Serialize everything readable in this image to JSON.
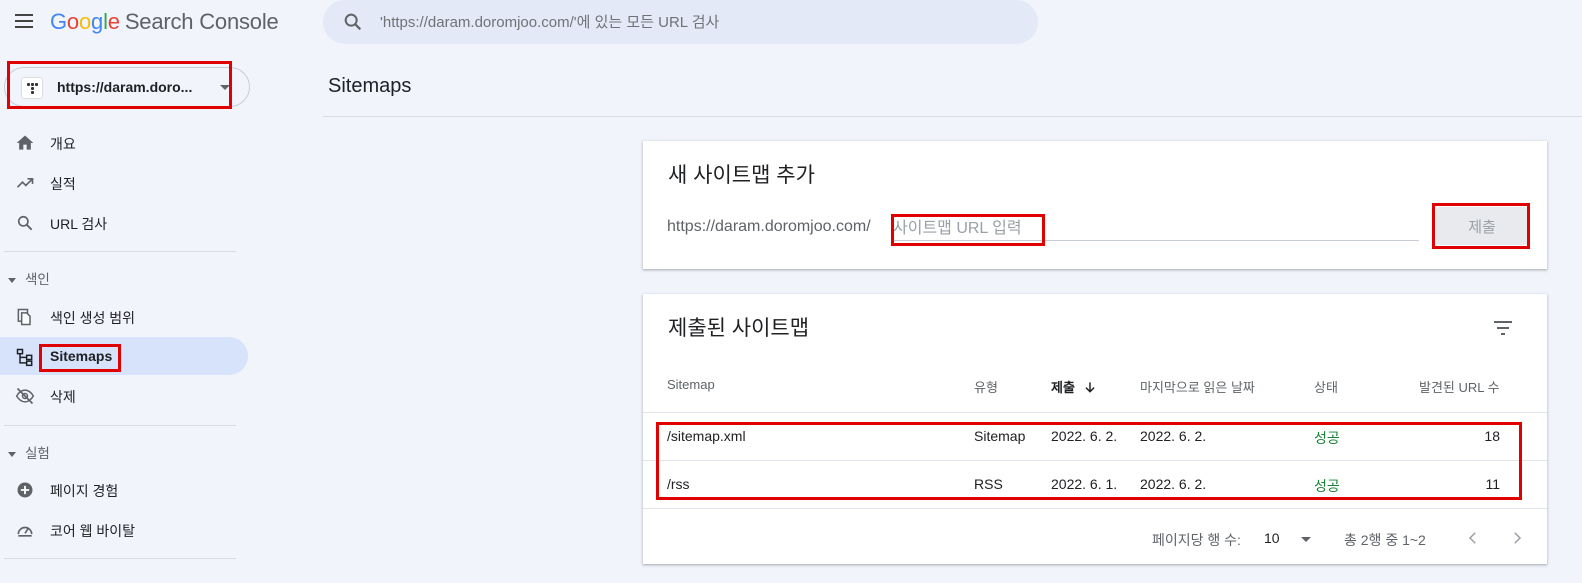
{
  "header": {
    "logo_letters": [
      "G",
      "o",
      "o",
      "g",
      "l",
      "e"
    ],
    "logo_product": "Search Console",
    "search_placeholder": "'https://daram.doromjoo.com/'에 있는 모든 URL 검사"
  },
  "property": {
    "url": "https://daram.doro..."
  },
  "sidebar": {
    "items": [
      {
        "label": "개요",
        "icon": "home-icon"
      },
      {
        "label": "실적",
        "icon": "trending-up-icon"
      },
      {
        "label": "URL 검사",
        "icon": "search-icon"
      }
    ],
    "section_index": "색인",
    "index_items": [
      {
        "label": "색인 생성 범위",
        "icon": "file-copy-icon"
      },
      {
        "label": "Sitemaps",
        "icon": "sitemap-icon",
        "active": true
      },
      {
        "label": "삭제",
        "icon": "visibility-off-icon"
      }
    ],
    "section_experience": "실험",
    "experience_items": [
      {
        "label": "페이지 경험",
        "icon": "plus-circle-icon"
      },
      {
        "label": "코어 웹 바이탈",
        "icon": "gauge-icon"
      }
    ]
  },
  "main": {
    "page_title": "Sitemaps",
    "add_card": {
      "title": "새 사이트맵 추가",
      "prefix": "https://daram.doromjoo.com/",
      "input_placeholder": "사이트맵 URL 입력",
      "submit_label": "제출"
    },
    "submitted_card": {
      "title": "제출된 사이트맵",
      "columns": [
        "Sitemap",
        "유형",
        "제출",
        "마지막으로 읽은 날짜",
        "상태",
        "발견된 URL 수"
      ],
      "sort_column": "제출",
      "rows": [
        {
          "sitemap": "/sitemap.xml",
          "type": "Sitemap",
          "submitted": "2022. 6. 2.",
          "last_read": "2022. 6. 2.",
          "status": "성공",
          "urls": "18"
        },
        {
          "sitemap": "/rss",
          "type": "RSS",
          "submitted": "2022. 6. 1.",
          "last_read": "2022. 6. 2.",
          "status": "성공",
          "urls": "11"
        }
      ],
      "rows_per_page_label": "페이지당 행 수:",
      "rows_per_page_value": "10",
      "range_label": "총 2행 중 1~2"
    }
  },
  "colors": {
    "accent": "#1a73e8",
    "success": "#188038",
    "highlight": "#e00000",
    "active_nav": "#d6e3fb"
  }
}
